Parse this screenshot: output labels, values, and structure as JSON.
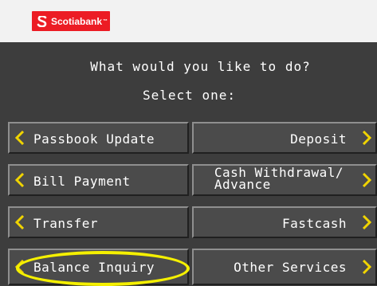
{
  "brand": {
    "name": "Scotiabank",
    "tm": "™",
    "color": "#ec1c24"
  },
  "prompt": {
    "title": "What would you like to do?",
    "subtitle": "Select one:"
  },
  "options": {
    "passbook": "Passbook Update",
    "deposit": "Deposit",
    "bill_payment": "Bill Payment",
    "cash_withdrawal": "Cash Withdrawal/\nAdvance",
    "transfer": "Transfer",
    "fastcash": "Fastcash",
    "balance_inquiry": "Balance Inquiry",
    "other_services": "Other Services"
  },
  "arrow_color": "#f0d400",
  "highlight_color": "#f5f000"
}
